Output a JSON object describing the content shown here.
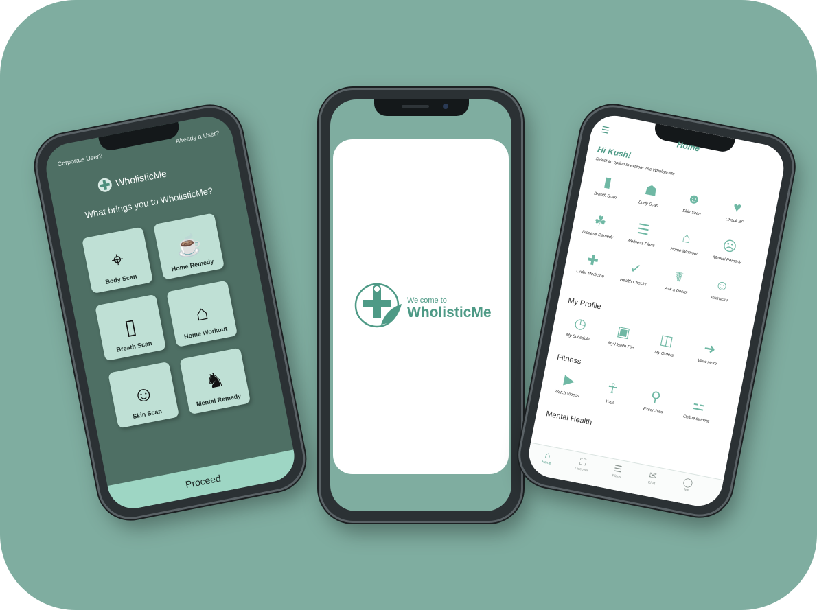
{
  "colors": {
    "background": "#7fada0",
    "brand_green": "#4e9a86",
    "left_screen": "#4e6f64",
    "tile": "#bfe0d5",
    "proceed_bar": "#9ed6c4"
  },
  "left_phone": {
    "corporate_link": "Corporate User?",
    "already_link": "Already a User?",
    "logo_text": "WholisticMe",
    "question": "What brings you to WholisticMe?",
    "tiles": [
      {
        "label": "Body Scan",
        "icon": "body-scan-icon",
        "glyph": "⌖"
      },
      {
        "label": "Home Remedy",
        "icon": "mortar-bowl-icon",
        "glyph": "☕"
      },
      {
        "label": "Breath Scan",
        "icon": "breathalyzer-icon",
        "glyph": "▯"
      },
      {
        "label": "Home Workout",
        "icon": "home-workout-icon",
        "glyph": "⌂"
      },
      {
        "label": "Skin Scan",
        "icon": "skin-scan-icon",
        "glyph": "☺"
      },
      {
        "label": "Mental Remedy",
        "icon": "mental-head-icon",
        "glyph": "♞"
      }
    ],
    "proceed_label": "Proceed"
  },
  "center_phone": {
    "welcome_small": "Welcome to",
    "welcome_big": "WholisticMe"
  },
  "right_phone": {
    "title": "Home",
    "greeting": "Hi Kush!",
    "subtitle": "Select an option to explore The WholisticMe",
    "services": [
      {
        "label": "Breath Scan",
        "icon": "breath-scan-icon",
        "glyph": "▮"
      },
      {
        "label": "Body Scan",
        "icon": "body-scan-icon",
        "glyph": "☗"
      },
      {
        "label": "Skin Scan",
        "icon": "skin-scan-icon",
        "glyph": "☻"
      },
      {
        "label": "Check BP",
        "icon": "bp-monitor-icon",
        "glyph": "♥"
      },
      {
        "label": "Disease Remedy",
        "icon": "remedy-bowl-icon",
        "glyph": "☘"
      },
      {
        "label": "Wellness Plans",
        "icon": "wellness-plan-icon",
        "glyph": "☰"
      },
      {
        "label": "Home Workout",
        "icon": "home-workout-icon",
        "glyph": "⌂"
      },
      {
        "label": "Mental Remedy",
        "icon": "mental-head-icon",
        "glyph": "☹"
      },
      {
        "label": "Order Medicine",
        "icon": "medicine-icon",
        "glyph": "✚"
      },
      {
        "label": "Health Checks",
        "icon": "clipboard-icon",
        "glyph": "✓"
      },
      {
        "label": "Ask a Doctor",
        "icon": "doctor-icon",
        "glyph": "☤"
      },
      {
        "label": "Instructor",
        "icon": "instructor-icon",
        "glyph": "☺"
      }
    ],
    "my_profile_heading": "My Profile",
    "profile_items": [
      {
        "label": "My Schedule",
        "icon": "clock-icon",
        "glyph": "◷"
      },
      {
        "label": "My Health File",
        "icon": "health-file-icon",
        "glyph": "▣"
      },
      {
        "label": "My Orders",
        "icon": "shopping-bag-icon",
        "glyph": "◫"
      },
      {
        "label": "View More",
        "icon": "arrow-right-icon",
        "glyph": "➜"
      }
    ],
    "fitness_heading": "Fitness",
    "fitness_items": [
      {
        "label": "Watch Videos",
        "icon": "video-icon",
        "glyph": "▶"
      },
      {
        "label": "Yoga",
        "icon": "yoga-icon",
        "glyph": "☥"
      },
      {
        "label": "Excercises",
        "icon": "exercise-icon",
        "glyph": "⚲"
      },
      {
        "label": "Online training",
        "icon": "dumbbell-icon",
        "glyph": "⚍"
      }
    ],
    "mental_health_heading": "Mental Health",
    "tabs": [
      {
        "label": "Home",
        "icon": "home-icon",
        "glyph": "⌂"
      },
      {
        "label": "Discover",
        "icon": "discover-icon",
        "glyph": "⛶"
      },
      {
        "label": "Plans",
        "icon": "plans-icon",
        "glyph": "☰"
      },
      {
        "label": "Chat",
        "icon": "chat-icon",
        "glyph": "✉"
      },
      {
        "label": "Me",
        "icon": "profile-icon",
        "glyph": "◯"
      }
    ]
  }
}
